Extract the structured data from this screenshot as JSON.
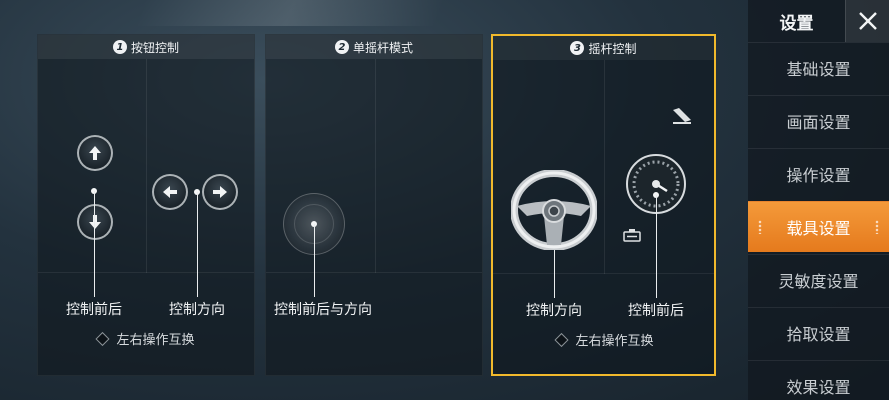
{
  "panels": [
    {
      "number": "1",
      "title": "按钮控制",
      "labels": [
        "控制前后",
        "控制方向"
      ],
      "swap": "左右操作互换",
      "icons": [
        "arrow-up-icon",
        "arrow-down-icon",
        "arrow-left-icon",
        "arrow-right-icon"
      ]
    },
    {
      "number": "2",
      "title": "单摇杆模式",
      "labels": [
        "控制前后与方向"
      ],
      "icons": [
        "joystick-icon"
      ]
    },
    {
      "number": "3",
      "title": "摇杆控制",
      "labels": [
        "控制方向",
        "控制前后"
      ],
      "swap": "左右操作互换",
      "selected": true,
      "icons": [
        "steering-wheel-icon",
        "speedometer-icon",
        "accelerator-pedal-icon",
        "brake-pedal-icon"
      ]
    }
  ],
  "sidebar": {
    "title": "设置",
    "close_icon": "close-icon",
    "items": [
      {
        "label": "基础设置"
      },
      {
        "label": "画面设置"
      },
      {
        "label": "操作设置"
      },
      {
        "label": "载具设置",
        "active": true
      },
      {
        "label": "灵敏度设置"
      },
      {
        "label": "拾取设置"
      },
      {
        "label": "效果设置"
      }
    ]
  },
  "colors": {
    "accent": "#f1b92c",
    "active_tab": "#ee8a2a"
  }
}
